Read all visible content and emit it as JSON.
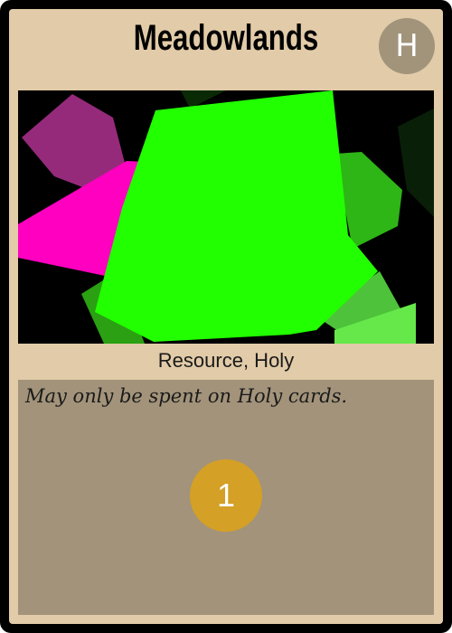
{
  "card": {
    "title": "Meadowlands",
    "badge_letter": "H",
    "type_line": "Resource, Holy",
    "rules_text": "May only be spent on Holy cards.",
    "cost": "1"
  },
  "colors": {
    "frame": "#000000",
    "parchment": "#e2cba8",
    "text_box": "#a2937a",
    "badge": "#a1947b",
    "cost_coin": "#d4a025",
    "art_bright_green": "#22ff00",
    "art_magenta": "#ff00c0",
    "art_purple": "#952a7b",
    "art_mid_green": "#2db615",
    "art_light_green": "#66e84a"
  }
}
